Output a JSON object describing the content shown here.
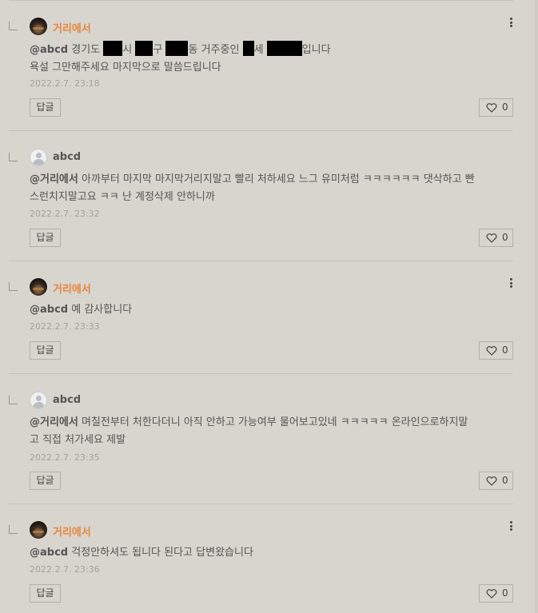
{
  "comments": [
    {
      "author": "거리에서",
      "mention": "@abcd",
      "text_parts": [
        "경기도",
        "시",
        "구",
        "동 거주중인",
        "세",
        "입니다"
      ],
      "text_line2": "욕설 그만해주세요 마지막으로 말씀드립니다",
      "date": "2022.2.7. 23:18",
      "reply_label": "답글",
      "like_count": "0"
    },
    {
      "author": "abcd",
      "mention": "@거리에서",
      "text": "아까부터 마지막 마지막거리지말고 빨리 처하세요 느그 유미처럼 ㅋㅋㅋㅋㅋㅋ 댓삭하고 빤",
      "text_line2": "스런치지말고요 ㅋㅋ 난 계정삭제 안하니까",
      "date": "2022.2.7. 23:32",
      "reply_label": "답글",
      "like_count": "0"
    },
    {
      "author": "거리에서",
      "mention": "@abcd",
      "text": "예 감사합니다",
      "date": "2022.2.7. 23:33",
      "reply_label": "답글",
      "like_count": "0"
    },
    {
      "author": "abcd",
      "mention": "@거리에서",
      "text": "며칠전부터 처한다더니 아직 안하고 가능여부 물어보고있네 ㅋㅋㅋㅋㅋ 온라인으로하지말",
      "text_line2": "고 직접 처가세요 제발",
      "date": "2022.2.7. 23:35",
      "reply_label": "답글",
      "like_count": "0"
    },
    {
      "author": "거리에서",
      "mention": "@abcd",
      "text": "걱정안하셔도 됩니다 된다고 답변왔습니다",
      "date": "2022.2.7. 23:36",
      "reply_label": "답글",
      "like_count": "0"
    }
  ],
  "colors": {
    "background": "#d8d4ce",
    "owner_name": "#e8863a",
    "date": "#a6a29b"
  }
}
